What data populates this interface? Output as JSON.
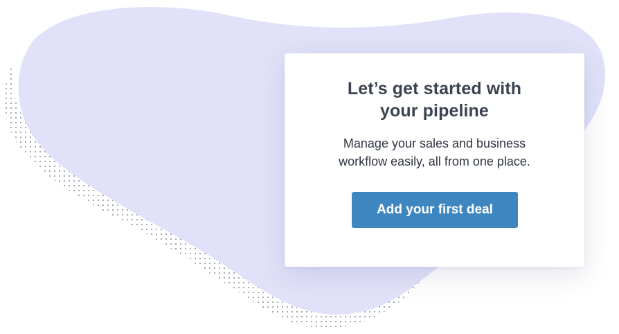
{
  "card": {
    "title_line1": "Let’s get started with",
    "title_line2": "your pipeline",
    "description_line1": "Manage your sales and business",
    "description_line2": "workflow easily, all from one place.",
    "cta_label": "Add your first deal"
  },
  "colors": {
    "blob": "#e1e2f9",
    "dots": "#8a8d99",
    "button": "#3e86c0",
    "title_text": "#3b4350"
  }
}
